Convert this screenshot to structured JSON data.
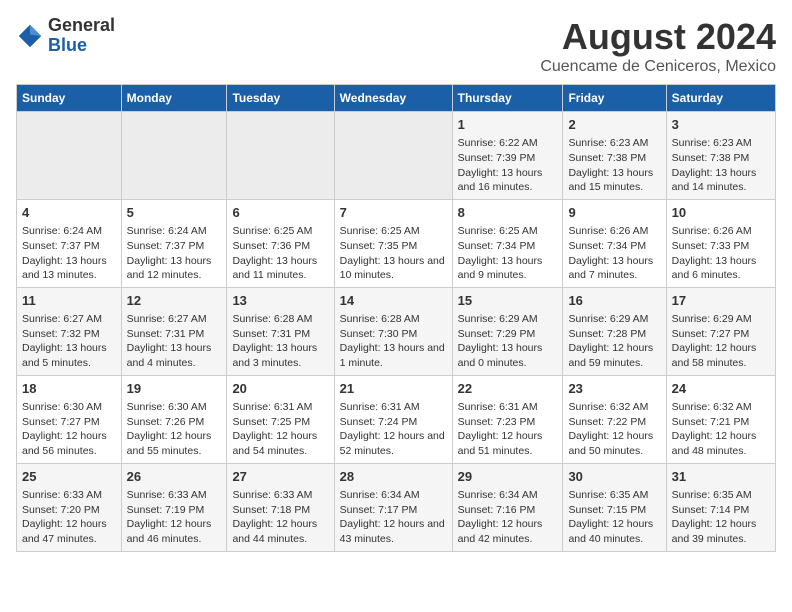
{
  "logo": {
    "general": "General",
    "blue": "Blue"
  },
  "header": {
    "title": "August 2024",
    "subtitle": "Cuencame de Ceniceros, Mexico"
  },
  "days_of_week": [
    "Sunday",
    "Monday",
    "Tuesday",
    "Wednesday",
    "Thursday",
    "Friday",
    "Saturday"
  ],
  "weeks": [
    [
      {
        "day": "",
        "empty": true
      },
      {
        "day": "",
        "empty": true
      },
      {
        "day": "",
        "empty": true
      },
      {
        "day": "",
        "empty": true
      },
      {
        "day": "1",
        "sunrise": "6:22 AM",
        "sunset": "7:39 PM",
        "daylight": "13 hours and 16 minutes."
      },
      {
        "day": "2",
        "sunrise": "6:23 AM",
        "sunset": "7:38 PM",
        "daylight": "13 hours and 15 minutes."
      },
      {
        "day": "3",
        "sunrise": "6:23 AM",
        "sunset": "7:38 PM",
        "daylight": "13 hours and 14 minutes."
      }
    ],
    [
      {
        "day": "4",
        "sunrise": "6:24 AM",
        "sunset": "7:37 PM",
        "daylight": "13 hours and 13 minutes."
      },
      {
        "day": "5",
        "sunrise": "6:24 AM",
        "sunset": "7:37 PM",
        "daylight": "13 hours and 12 minutes."
      },
      {
        "day": "6",
        "sunrise": "6:25 AM",
        "sunset": "7:36 PM",
        "daylight": "13 hours and 11 minutes."
      },
      {
        "day": "7",
        "sunrise": "6:25 AM",
        "sunset": "7:35 PM",
        "daylight": "13 hours and 10 minutes."
      },
      {
        "day": "8",
        "sunrise": "6:25 AM",
        "sunset": "7:34 PM",
        "daylight": "13 hours and 9 minutes."
      },
      {
        "day": "9",
        "sunrise": "6:26 AM",
        "sunset": "7:34 PM",
        "daylight": "13 hours and 7 minutes."
      },
      {
        "day": "10",
        "sunrise": "6:26 AM",
        "sunset": "7:33 PM",
        "daylight": "13 hours and 6 minutes."
      }
    ],
    [
      {
        "day": "11",
        "sunrise": "6:27 AM",
        "sunset": "7:32 PM",
        "daylight": "13 hours and 5 minutes."
      },
      {
        "day": "12",
        "sunrise": "6:27 AM",
        "sunset": "7:31 PM",
        "daylight": "13 hours and 4 minutes."
      },
      {
        "day": "13",
        "sunrise": "6:28 AM",
        "sunset": "7:31 PM",
        "daylight": "13 hours and 3 minutes."
      },
      {
        "day": "14",
        "sunrise": "6:28 AM",
        "sunset": "7:30 PM",
        "daylight": "13 hours and 1 minute."
      },
      {
        "day": "15",
        "sunrise": "6:29 AM",
        "sunset": "7:29 PM",
        "daylight": "13 hours and 0 minutes."
      },
      {
        "day": "16",
        "sunrise": "6:29 AM",
        "sunset": "7:28 PM",
        "daylight": "12 hours and 59 minutes."
      },
      {
        "day": "17",
        "sunrise": "6:29 AM",
        "sunset": "7:27 PM",
        "daylight": "12 hours and 58 minutes."
      }
    ],
    [
      {
        "day": "18",
        "sunrise": "6:30 AM",
        "sunset": "7:27 PM",
        "daylight": "12 hours and 56 minutes."
      },
      {
        "day": "19",
        "sunrise": "6:30 AM",
        "sunset": "7:26 PM",
        "daylight": "12 hours and 55 minutes."
      },
      {
        "day": "20",
        "sunrise": "6:31 AM",
        "sunset": "7:25 PM",
        "daylight": "12 hours and 54 minutes."
      },
      {
        "day": "21",
        "sunrise": "6:31 AM",
        "sunset": "7:24 PM",
        "daylight": "12 hours and 52 minutes."
      },
      {
        "day": "22",
        "sunrise": "6:31 AM",
        "sunset": "7:23 PM",
        "daylight": "12 hours and 51 minutes."
      },
      {
        "day": "23",
        "sunrise": "6:32 AM",
        "sunset": "7:22 PM",
        "daylight": "12 hours and 50 minutes."
      },
      {
        "day": "24",
        "sunrise": "6:32 AM",
        "sunset": "7:21 PM",
        "daylight": "12 hours and 48 minutes."
      }
    ],
    [
      {
        "day": "25",
        "sunrise": "6:33 AM",
        "sunset": "7:20 PM",
        "daylight": "12 hours and 47 minutes."
      },
      {
        "day": "26",
        "sunrise": "6:33 AM",
        "sunset": "7:19 PM",
        "daylight": "12 hours and 46 minutes."
      },
      {
        "day": "27",
        "sunrise": "6:33 AM",
        "sunset": "7:18 PM",
        "daylight": "12 hours and 44 minutes."
      },
      {
        "day": "28",
        "sunrise": "6:34 AM",
        "sunset": "7:17 PM",
        "daylight": "12 hours and 43 minutes."
      },
      {
        "day": "29",
        "sunrise": "6:34 AM",
        "sunset": "7:16 PM",
        "daylight": "12 hours and 42 minutes."
      },
      {
        "day": "30",
        "sunrise": "6:35 AM",
        "sunset": "7:15 PM",
        "daylight": "12 hours and 40 minutes."
      },
      {
        "day": "31",
        "sunrise": "6:35 AM",
        "sunset": "7:14 PM",
        "daylight": "12 hours and 39 minutes."
      }
    ]
  ],
  "labels": {
    "sunrise": "Sunrise:",
    "sunset": "Sunset:",
    "daylight": "Daylight:"
  }
}
